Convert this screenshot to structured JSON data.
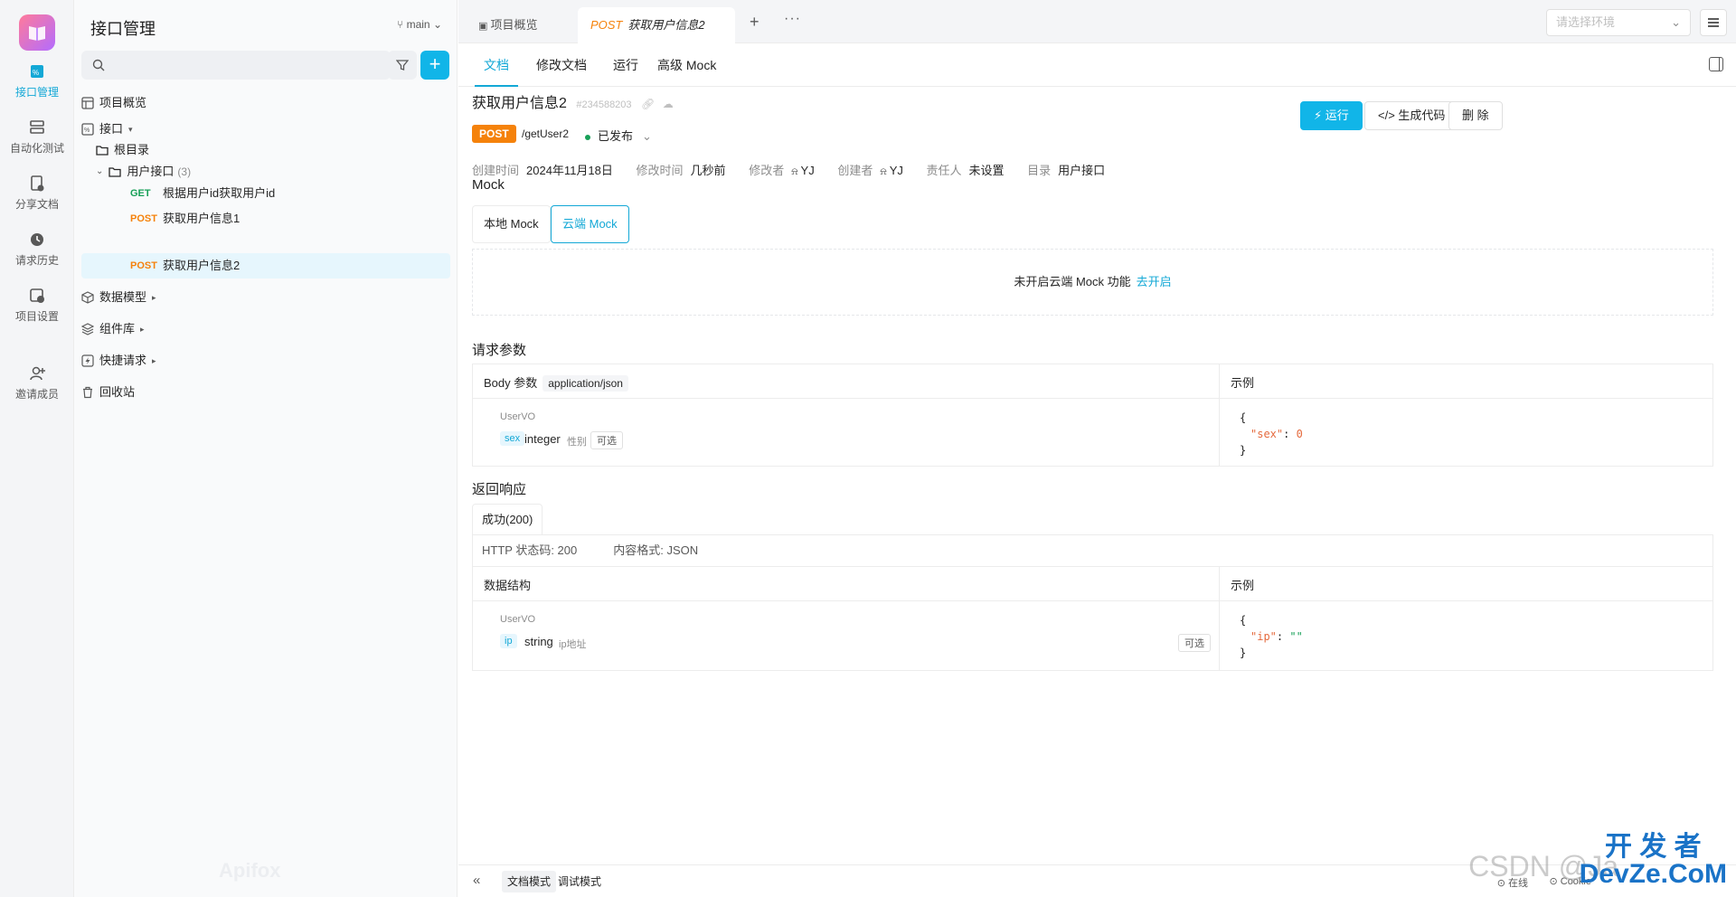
{
  "rail": {
    "items": [
      {
        "label": "接口管理",
        "active": true
      },
      {
        "label": "自动化测试"
      },
      {
        "label": "分享文档"
      },
      {
        "label": "请求历史"
      },
      {
        "label": "项目设置"
      },
      {
        "label": "邀请成员"
      }
    ]
  },
  "sidebar": {
    "title": "接口管理",
    "branch": "main",
    "tree": {
      "overview": "项目概览",
      "interfaces": "接口",
      "root": "根目录",
      "folder": "用户接口",
      "folder_count": "(3)",
      "apis": [
        {
          "method": "GET",
          "name": "根据用户id获取用户id"
        },
        {
          "method": "POST",
          "name": "获取用户信息1"
        },
        {
          "method": "POST",
          "name": "获取用户信息2"
        }
      ],
      "models": "数据模型",
      "components": "组件库",
      "quick": "快捷请求",
      "trash": "回收站"
    },
    "watermark": "Apifox"
  },
  "topbar": {
    "tab_overview": "项目概览",
    "tab_active_method": "POST",
    "tab_active_title": "获取用户信息2",
    "env_placeholder": "请选择环境"
  },
  "subtabs": [
    "文档",
    "修改文档",
    "运行",
    "高级 Mock"
  ],
  "api": {
    "name": "获取用户信息2",
    "id": "#234588203",
    "method": "POST",
    "path": "/getUser2",
    "status": "已发布",
    "buttons": {
      "run": "运行",
      "gen": "生成代码",
      "delete": "删 除"
    },
    "meta": {
      "created_k": "创建时间",
      "created_v": "2024年11月18日",
      "modified_k": "修改时间",
      "modified_v": "几秒前",
      "modifier_k": "修改者",
      "modifier_v": "YJ",
      "creator_k": "创建者",
      "creator_v": "YJ",
      "owner_k": "责任人",
      "owner_v": "未设置",
      "dir_k": "目录",
      "dir_v": "用户接口"
    }
  },
  "mock": {
    "title": "Mock",
    "tab_local": "本地 Mock",
    "tab_cloud": "云端 Mock",
    "disabled_text": "未开启云端 Mock 功能",
    "enable_link": "去开启"
  },
  "request": {
    "title": "请求参数",
    "body_label": "Body 参数",
    "content_type": "application/json",
    "example_label": "示例",
    "schema": "UserVO",
    "field": {
      "name": "sex",
      "type": "integer",
      "desc": "性别",
      "optional": "可选"
    },
    "example": {
      "open": "{",
      "key": "\"sex\"",
      "colon": ": ",
      "value": "0",
      "close": "}"
    }
  },
  "response": {
    "title": "返回响应",
    "tab": "成功(200)",
    "http_status": "HTTP 状态码: 200",
    "content_format": "内容格式: JSON",
    "struct_label": "数据结构",
    "example_label": "示例",
    "schema": "UserVO",
    "field": {
      "name": "ip",
      "type": "string",
      "desc": "ip地址",
      "optional": "可选"
    },
    "example": {
      "open": "{",
      "key": "\"ip\"",
      "colon": ": ",
      "value": "\"\"",
      "close": "}"
    }
  },
  "bottombar": {
    "doc_mode": "文档模式",
    "debug_mode": "调试模式",
    "online": "在线",
    "cookie": "Cookie"
  },
  "watermarks": {
    "csdn": "CSDN @Ja",
    "devze_top": "开 发 者",
    "devze_bottom": "DevZe.CoM"
  },
  "colors": {
    "accent": "#13a8d6",
    "post": "#f5820b",
    "get": "#18a058"
  }
}
